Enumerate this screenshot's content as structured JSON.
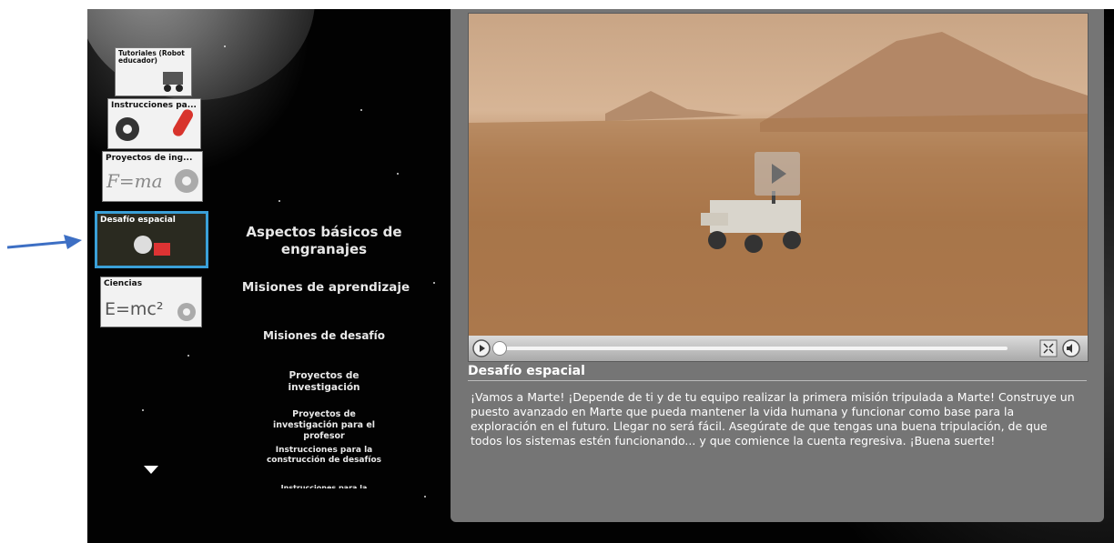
{
  "sidebar": {
    "items": [
      {
        "label": "Tutoriales (Robot educador)"
      },
      {
        "label": "Instrucciones pa..."
      },
      {
        "label": "Proyectos de ing..."
      },
      {
        "label": "Desafío espacial"
      },
      {
        "label": "Ciencias"
      }
    ]
  },
  "thumbs": {
    "physics_formula": "F=ma",
    "science_formula": "E=mc²"
  },
  "menu": {
    "items": [
      {
        "label": "Aspectos básicos de engranajes"
      },
      {
        "label": "Misiones de aprendizaje"
      },
      {
        "label": "Misiones de desafío"
      },
      {
        "label": "Proyectos de investigación"
      },
      {
        "label": "Proyectos de investigación para el profesor"
      },
      {
        "label": "Instrucciones para la construcción de desafíos"
      },
      {
        "label": "Instrucciones para la"
      }
    ]
  },
  "video": {
    "progress": 0.0
  },
  "content": {
    "title": "Desafío espacial",
    "description": "¡Vamos a Marte! ¡Depende de ti y de tu equipo realizar la primera misión tripulada a Marte! Construye un puesto avanzado en Marte que pueda mantener la vida humana y funcionar como base para la exploración en el futuro. Llegar no será fácil. Asegúrate de que tengas una buena tripulación, de que todos los sistemas estén funcionando... y que comience la cuenta regresiva. ¡Buena suerte!"
  },
  "colors": {
    "accent": "#3aa0d8",
    "annotation_arrow": "#3d6fc4"
  }
}
